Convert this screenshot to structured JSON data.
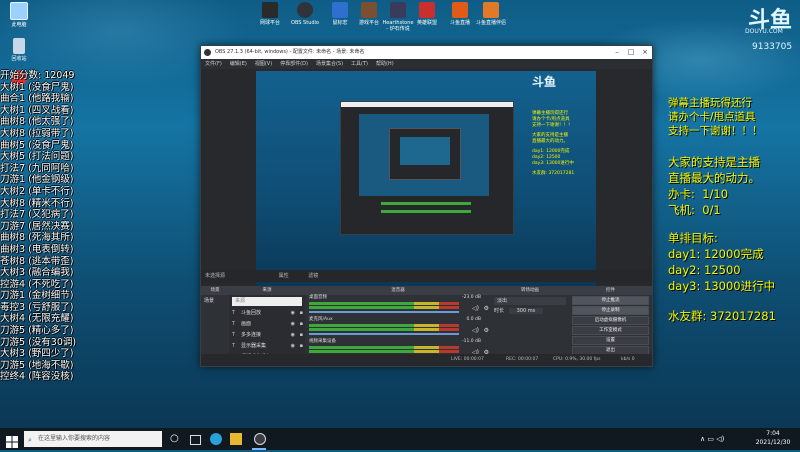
{
  "desktop": {
    "icons": [
      {
        "label": "此电脑",
        "color": "#9bd0ff"
      },
      {
        "label": "回收站",
        "color": "#c8d8e8"
      },
      {
        "label": "网易云音乐",
        "color": "#e03030"
      }
    ],
    "top_icons": [
      {
        "label": "网球平台",
        "color": "#2a2a2a"
      },
      {
        "label": "OBS Studio",
        "color": "#30343a"
      },
      {
        "label": "鼠标宏",
        "color": "#2f6fd0"
      },
      {
        "label": "游戏平台",
        "color": "#7a5030"
      },
      {
        "label": "Hearthstone - 炉石传说",
        "color": "#3a3a5a"
      },
      {
        "label": "英雄联盟",
        "color": "#c83030"
      },
      {
        "label": "斗鱼直播",
        "color": "#e05a18"
      },
      {
        "label": "斗鱼直播伴侣",
        "color": "#e07a28"
      }
    ]
  },
  "left_overlay": {
    "header": "开始分数: 12049",
    "rows": [
      "大树1 (没食尸鬼)",
      "曲合1 (他路我输)",
      "大树1 (四叉战看)",
      "曲树8 (他太强了)",
      "大树8 (拉弱带了)",
      "曲树5 (没食尸鬼)",
      "大树5 (打法问题)",
      "打法7 (九同阿哈)",
      "刀游1 (他金钢级)",
      "大树2 (单卡不行)",
      "大树8 (精米不行)",
      "打法7 (又犯病了)",
      "刀游7 (居然决赛)",
      "曲树8 (死海其所)",
      "曲树3 (电表倒转)",
      "苍树8 (逃本带歪)",
      "大树3 (融合编我)",
      "控游4 (不死吃了)",
      "刀游1 (金树细节)",
      "毒控3 (亏舒服了)",
      "大树4 (无限充耀)",
      "刀游5 (精心多了)",
      "刀游5 (没有30调)",
      "大树3 (野四少了)",
      "刀游5 (地海不歇)",
      "控终4 (阵容没核)"
    ]
  },
  "right_overlay": {
    "line1": "弹幕主播玩得还行",
    "line2": "请办个卡/甩点道具",
    "line3": "支持一下谢谢！！！",
    "line4": "大家的支持是主播",
    "line5": "直播最大的动力。",
    "card_label": "办卡:",
    "card_value": "1/10",
    "plane_label": "飞机:",
    "plane_value": "0/1",
    "target_title": "单排目标:",
    "day1": "day1:  12000完成",
    "day2": "day2:  12500",
    "day3": "day3:  13000进行中",
    "group": "水友群:  372017281"
  },
  "logo": {
    "text": "斗鱼",
    "sub": "DOUYU.COM",
    "room": "9133705"
  },
  "obs": {
    "title": "OBS 27.1.3 (64-bit, windows) - 配置文件: 未命名 - 场景: 未命名",
    "menu": [
      "文件(F)",
      "编辑(E)",
      "视图(V)",
      "停靠部件(D)",
      "场景集合(S)",
      "工具(T)",
      "帮助(H)"
    ],
    "scene_bar_label": "未选择源",
    "scene_bar_props": "属性",
    "scene_bar_filters": "滤镜",
    "docks": {
      "scenes": {
        "title": "场景",
        "items": [
          "场景"
        ]
      },
      "sources": {
        "title": "来源",
        "search": "来源",
        "items": [
          "斗鱼回放",
          "画面",
          "多多连接",
          "显示器采集",
          "视频采集设备"
        ]
      },
      "mixer": {
        "title": "混音器",
        "tracks": [
          {
            "name": "桌面音频",
            "db": "-23.0 dB"
          },
          {
            "name": "麦克风/Aux",
            "db": "0.0 dB"
          },
          {
            "name": "视频采集设备",
            "db": "-11.0 dB"
          }
        ]
      },
      "transitions": {
        "title": "转场动画",
        "type": "淡出",
        "duration_label": "时长",
        "duration": "300 ms"
      },
      "controls": {
        "title": "控件",
        "buttons": [
          "停止推流",
          "停止录制",
          "启动虚拟摄像机",
          "工作室模式",
          "设置",
          "退出"
        ]
      }
    },
    "status": {
      "live": "LIVE: 00:00:07",
      "rec": "REC: 00:00:07",
      "cpu": "CPU: 0.9%, 30.00 fps",
      "kbps": "kb/s 0"
    }
  },
  "taskbar": {
    "search_placeholder": "在这里输入你要搜索的内容",
    "time": "7:04",
    "date": "2021/12/30"
  },
  "colors": {
    "overlay_yellow": "#f5f500",
    "obs_bg": "#27292d",
    "taskbar": "#101820"
  }
}
